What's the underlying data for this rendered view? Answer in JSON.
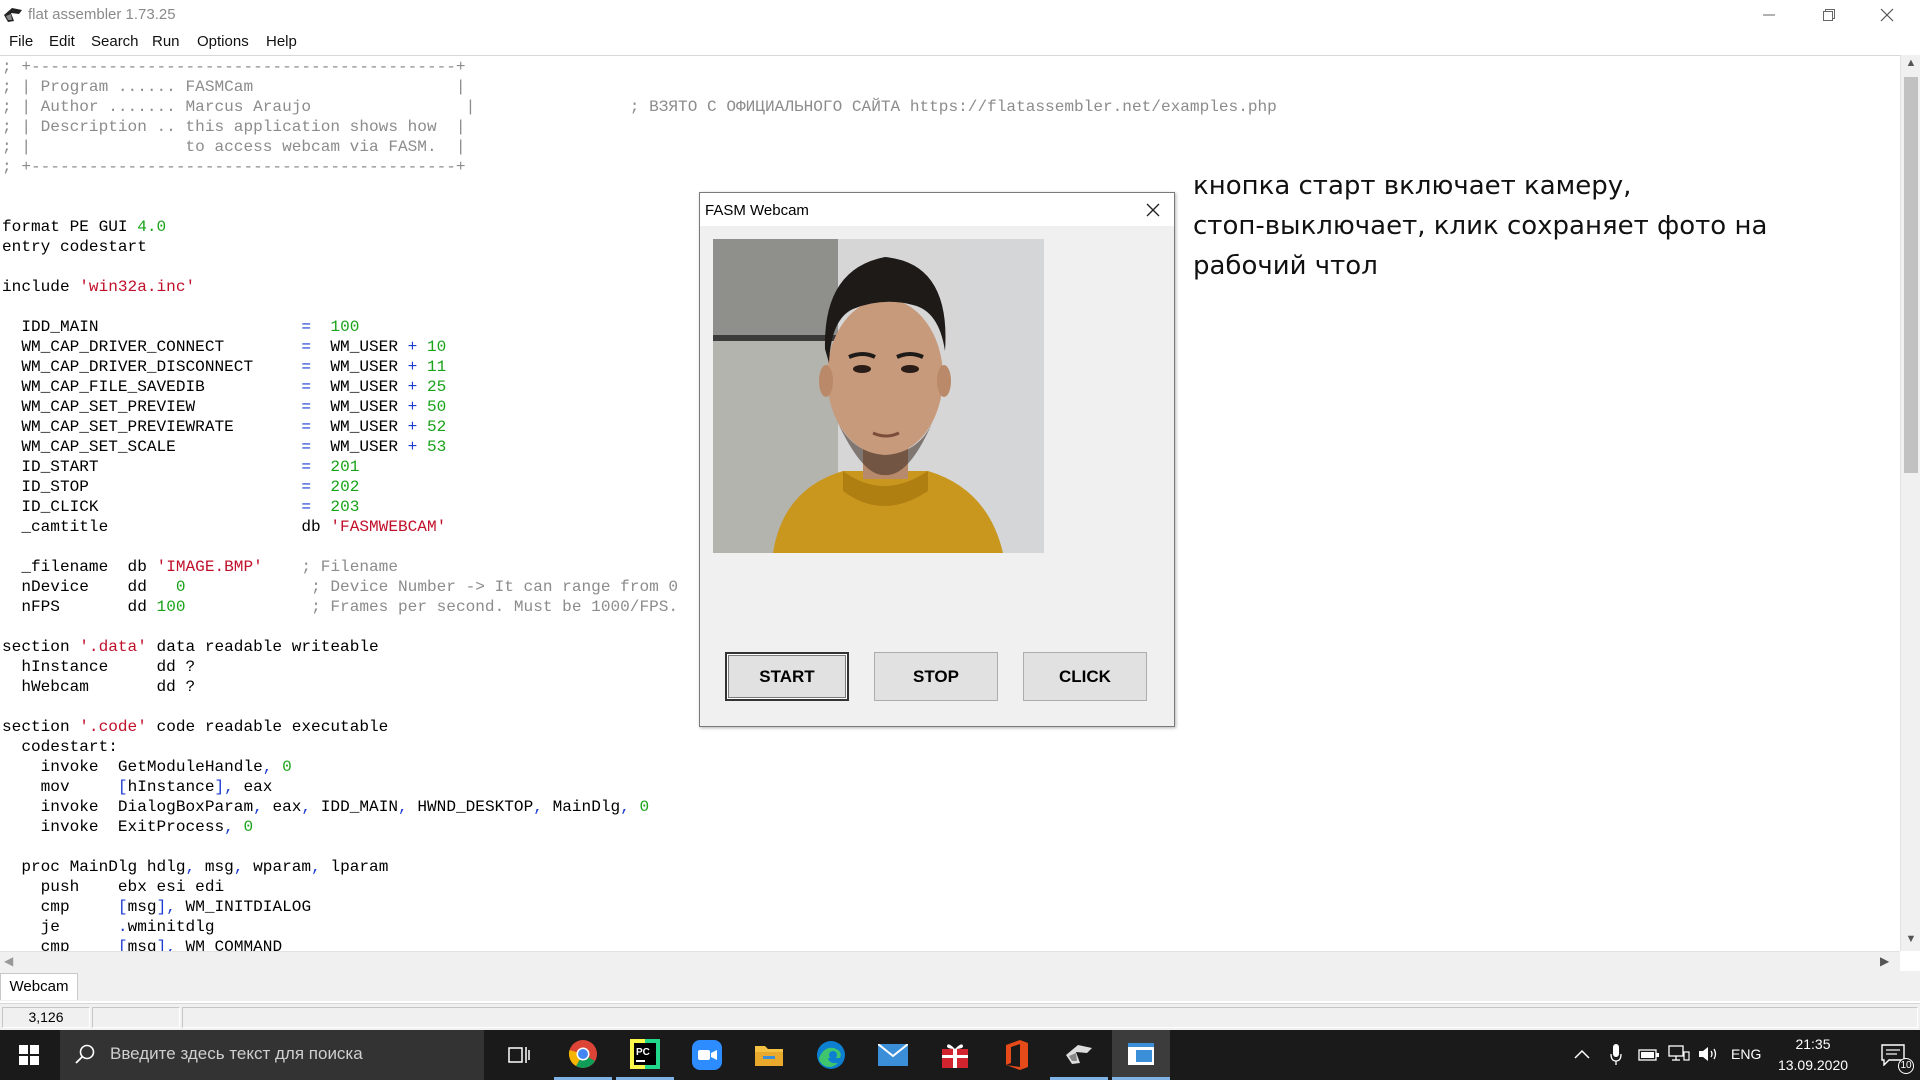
{
  "window": {
    "title": "flat assembler 1.73.25"
  },
  "menu": [
    "File",
    "Edit",
    "Search",
    "Run",
    "Options",
    "Help"
  ],
  "editor": {
    "lines": [
      {
        "segs": [
          {
            "t": "; +--------------------------------------------+",
            "c": "cm"
          }
        ]
      },
      {
        "segs": [
          {
            "t": "; | Program ...... FASMCam                     |",
            "c": "cm"
          }
        ]
      },
      {
        "segs": [
          {
            "t": "; | Author ....... Marcus Araujo                |                ; ВЗЯТО С ОФИЦИАЛЬНОГО САЙТА https://flatassembler.net/examples.php",
            "c": "cm"
          }
        ]
      },
      {
        "segs": [
          {
            "t": "; | Description .. this application shows how  |",
            "c": "cm"
          }
        ]
      },
      {
        "segs": [
          {
            "t": "; |                to access webcam via FASM.  |",
            "c": "cm"
          }
        ]
      },
      {
        "segs": [
          {
            "t": "; +--------------------------------------------+",
            "c": "cm"
          }
        ]
      },
      {
        "segs": []
      },
      {
        "segs": []
      },
      {
        "segs": [
          {
            "t": "format PE GUI "
          },
          {
            "t": "4.0",
            "c": "num"
          }
        ]
      },
      {
        "segs": [
          {
            "t": "entry codestart"
          }
        ]
      },
      {
        "segs": []
      },
      {
        "segs": [
          {
            "t": "include "
          },
          {
            "t": "'win32a.inc'",
            "c": "str"
          }
        ]
      },
      {
        "segs": []
      },
      {
        "segs": [
          {
            "t": "  IDD_MAIN                     "
          },
          {
            "t": "=",
            "c": "sym"
          },
          {
            "t": "  "
          },
          {
            "t": "100",
            "c": "num"
          }
        ]
      },
      {
        "segs": [
          {
            "t": "  WM_CAP_DRIVER_CONNECT        "
          },
          {
            "t": "=",
            "c": "sym"
          },
          {
            "t": "  WM_USER "
          },
          {
            "t": "+",
            "c": "sym"
          },
          {
            "t": " "
          },
          {
            "t": "10",
            "c": "num"
          }
        ]
      },
      {
        "segs": [
          {
            "t": "  WM_CAP_DRIVER_DISCONNECT     "
          },
          {
            "t": "=",
            "c": "sym"
          },
          {
            "t": "  WM_USER "
          },
          {
            "t": "+",
            "c": "sym"
          },
          {
            "t": " "
          },
          {
            "t": "11",
            "c": "num"
          }
        ]
      },
      {
        "segs": [
          {
            "t": "  WM_CAP_FILE_SAVEDIB          "
          },
          {
            "t": "=",
            "c": "sym"
          },
          {
            "t": "  WM_USER "
          },
          {
            "t": "+",
            "c": "sym"
          },
          {
            "t": " "
          },
          {
            "t": "25",
            "c": "num"
          }
        ]
      },
      {
        "segs": [
          {
            "t": "  WM_CAP_SET_PREVIEW           "
          },
          {
            "t": "=",
            "c": "sym"
          },
          {
            "t": "  WM_USER "
          },
          {
            "t": "+",
            "c": "sym"
          },
          {
            "t": " "
          },
          {
            "t": "50",
            "c": "num"
          }
        ]
      },
      {
        "segs": [
          {
            "t": "  WM_CAP_SET_PREVIEWRATE       "
          },
          {
            "t": "=",
            "c": "sym"
          },
          {
            "t": "  WM_USER "
          },
          {
            "t": "+",
            "c": "sym"
          },
          {
            "t": " "
          },
          {
            "t": "52",
            "c": "num"
          }
        ]
      },
      {
        "segs": [
          {
            "t": "  WM_CAP_SET_SCALE             "
          },
          {
            "t": "=",
            "c": "sym"
          },
          {
            "t": "  WM_USER "
          },
          {
            "t": "+",
            "c": "sym"
          },
          {
            "t": " "
          },
          {
            "t": "53",
            "c": "num"
          }
        ]
      },
      {
        "segs": [
          {
            "t": "  ID_START                     "
          },
          {
            "t": "=",
            "c": "sym"
          },
          {
            "t": "  "
          },
          {
            "t": "201",
            "c": "num"
          }
        ]
      },
      {
        "segs": [
          {
            "t": "  ID_STOP                      "
          },
          {
            "t": "=",
            "c": "sym"
          },
          {
            "t": "  "
          },
          {
            "t": "202",
            "c": "num"
          }
        ]
      },
      {
        "segs": [
          {
            "t": "  ID_CLICK                     "
          },
          {
            "t": "=",
            "c": "sym"
          },
          {
            "t": "  "
          },
          {
            "t": "203",
            "c": "num"
          }
        ]
      },
      {
        "segs": [
          {
            "t": "  _camtitle                    db "
          },
          {
            "t": "'FASMWEBCAM'",
            "c": "str"
          }
        ]
      },
      {
        "segs": []
      },
      {
        "segs": [
          {
            "t": "  _filename  db "
          },
          {
            "t": "'IMAGE.BMP'",
            "c": "str"
          },
          {
            "t": "    "
          },
          {
            "t": "; Filename",
            "c": "cm"
          }
        ]
      },
      {
        "segs": [
          {
            "t": "  nDevice    dd   "
          },
          {
            "t": "0",
            "c": "num"
          },
          {
            "t": "             "
          },
          {
            "t": "; Device Number -> It can range from 0",
            "c": "cm"
          }
        ]
      },
      {
        "segs": [
          {
            "t": "  nFPS       dd "
          },
          {
            "t": "100",
            "c": "num"
          },
          {
            "t": "             "
          },
          {
            "t": "; Frames per second. Must be 1000/FPS.",
            "c": "cm"
          }
        ]
      },
      {
        "segs": []
      },
      {
        "segs": [
          {
            "t": "section "
          },
          {
            "t": "'.data'",
            "c": "str"
          },
          {
            "t": " data readable writeable"
          }
        ]
      },
      {
        "segs": [
          {
            "t": "  hInstance     dd ?"
          }
        ]
      },
      {
        "segs": [
          {
            "t": "  hWebcam       dd ?"
          }
        ]
      },
      {
        "segs": []
      },
      {
        "segs": [
          {
            "t": "section "
          },
          {
            "t": "'.code'",
            "c": "str"
          },
          {
            "t": " code readable executable"
          }
        ]
      },
      {
        "segs": [
          {
            "t": "  codestart:"
          }
        ]
      },
      {
        "segs": [
          {
            "t": "    invoke  GetModuleHandle"
          },
          {
            "t": ",",
            "c": "sym"
          },
          {
            "t": " "
          },
          {
            "t": "0",
            "c": "num"
          }
        ]
      },
      {
        "segs": [
          {
            "t": "    mov     "
          },
          {
            "t": "[",
            "c": "sym"
          },
          {
            "t": "hInstance"
          },
          {
            "t": "],",
            "c": "sym"
          },
          {
            "t": " eax"
          }
        ]
      },
      {
        "segs": [
          {
            "t": "    invoke  DialogBoxParam"
          },
          {
            "t": ",",
            "c": "sym"
          },
          {
            "t": " eax"
          },
          {
            "t": ",",
            "c": "sym"
          },
          {
            "t": " IDD_MAIN"
          },
          {
            "t": ",",
            "c": "sym"
          },
          {
            "t": " HWND_DESKTOP"
          },
          {
            "t": ",",
            "c": "sym"
          },
          {
            "t": " MainDlg"
          },
          {
            "t": ",",
            "c": "sym"
          },
          {
            "t": " "
          },
          {
            "t": "0",
            "c": "num"
          }
        ]
      },
      {
        "segs": [
          {
            "t": "    invoke  ExitProcess"
          },
          {
            "t": ",",
            "c": "sym"
          },
          {
            "t": " "
          },
          {
            "t": "0",
            "c": "num"
          }
        ]
      },
      {
        "segs": []
      },
      {
        "segs": [
          {
            "t": "  proc MainDlg hdlg"
          },
          {
            "t": ",",
            "c": "sym"
          },
          {
            "t": " msg"
          },
          {
            "t": ",",
            "c": "sym"
          },
          {
            "t": " wparam"
          },
          {
            "t": ",",
            "c": "sym"
          },
          {
            "t": " lparam"
          }
        ]
      },
      {
        "segs": [
          {
            "t": "    push    ebx esi edi"
          }
        ]
      },
      {
        "segs": [
          {
            "t": "    cmp     "
          },
          {
            "t": "[",
            "c": "sym"
          },
          {
            "t": "msg"
          },
          {
            "t": "],",
            "c": "sym"
          },
          {
            "t": " WM_INITDIALOG"
          }
        ]
      },
      {
        "segs": [
          {
            "t": "    je      "
          },
          {
            "t": ".",
            "c": "sym"
          },
          {
            "t": "wminitdlg"
          }
        ]
      },
      {
        "segs": [
          {
            "t": "    cmp     "
          },
          {
            "t": "[",
            "c": "sym"
          },
          {
            "t": "msg"
          },
          {
            "t": "],",
            "c": "sym"
          },
          {
            "t": " WM_COMMAND"
          }
        ]
      }
    ]
  },
  "tabs": [
    "Webcam"
  ],
  "status": {
    "position": "3,126"
  },
  "dialog": {
    "title": "FASM Webcam",
    "buttons": {
      "start": "START",
      "stop": "STOP",
      "click": "CLICK"
    }
  },
  "annotation": {
    "lines": [
      "кнопка старт включает камеру,",
      "стоп-выключает, клик сохраняет фото на",
      "рабочий чтол"
    ]
  },
  "taskbar": {
    "search_placeholder": "Введите здесь текст для поиска",
    "apps": [
      "task-view-icon",
      "chrome-icon",
      "pycharm-icon",
      "zoom-icon",
      "file-explorer-icon",
      "edge-icon",
      "mail-icon",
      "gift-icon",
      "office-icon",
      "fasm-icon",
      "active-app-icon"
    ],
    "language": "ENG",
    "time": "21:35",
    "date": "13.09.2020",
    "notifications": "10"
  }
}
